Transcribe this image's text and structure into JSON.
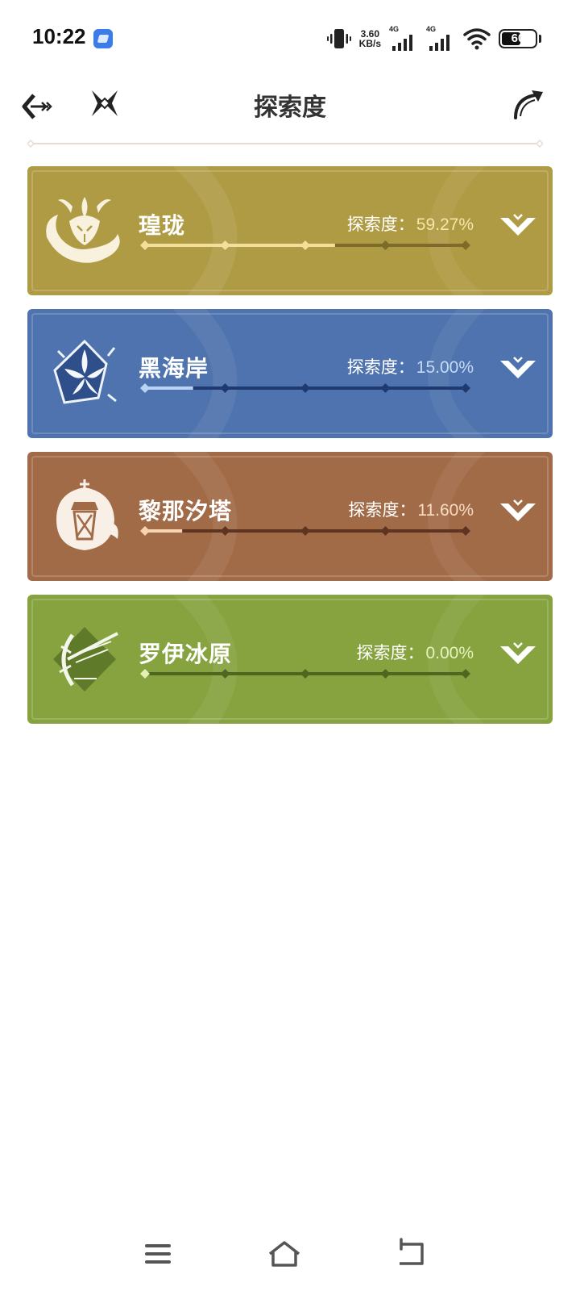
{
  "status_bar": {
    "time": "10:22",
    "net_speed_value": "3.60",
    "net_speed_unit": "KB/s",
    "sim1_tag": "4G",
    "sim2_tag": "4G",
    "battery_level": "60",
    "battery_fraction": 0.6
  },
  "header": {
    "title": "探索度"
  },
  "regions": [
    {
      "name": "瑝珑",
      "rate_label": "探索度：",
      "rate_value": "59.27%",
      "progress": 0.5927,
      "bg_color": "#b09b45",
      "fill_color": "#f2df9a",
      "track_color": "#7d6b2c",
      "value_color": "#f5e6a8",
      "emblem": "dragon-emblem-icon"
    },
    {
      "name": "黑海岸",
      "rate_label": "探索度：",
      "rate_value": "15.00%",
      "progress": 0.15,
      "bg_color": "#4e73ae",
      "fill_color": "#b9d3f5",
      "track_color": "#1e3a70",
      "value_color": "#c4dbf7",
      "emblem": "star-flower-emblem-icon"
    },
    {
      "name": "黎那汐塔",
      "rate_label": "探索度：",
      "rate_value": "11.60%",
      "progress": 0.116,
      "bg_color": "#a26b48",
      "fill_color": "#f7d3b0",
      "track_color": "#5d3420",
      "value_color": "#f8dcc1",
      "emblem": "lantern-emblem-icon"
    },
    {
      "name": "罗伊冰原",
      "rate_label": "探索度：",
      "rate_value": "0.00%",
      "progress": 0.0,
      "bg_color": "#86a33f",
      "fill_color": "#e4f0b8",
      "track_color": "#4f6620",
      "value_color": "#e7f2c0",
      "emblem": "ice-crest-emblem-icon"
    }
  ],
  "nav_bar": {
    "menu_icon": "menu-icon",
    "home_icon": "home-icon",
    "back_icon": "back-icon"
  }
}
